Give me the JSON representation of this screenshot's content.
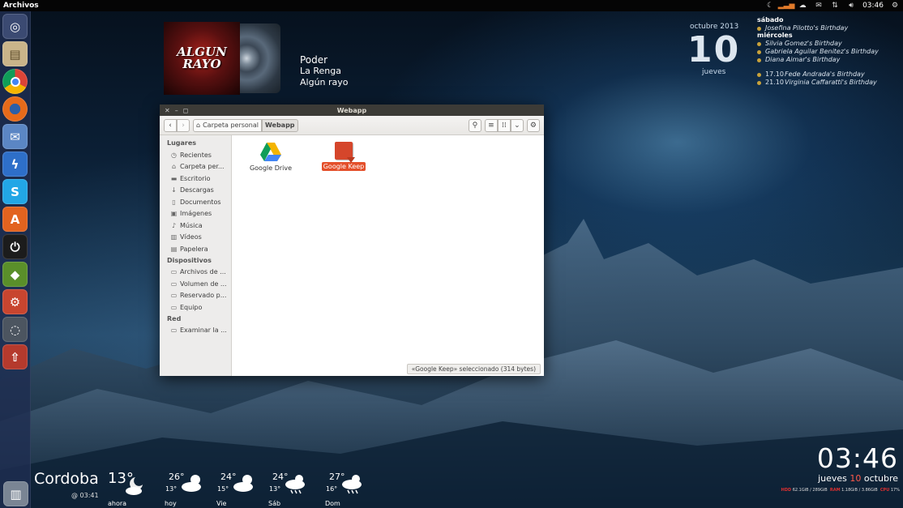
{
  "top_panel": {
    "title": "Archivos",
    "time": "03:46",
    "indicators": [
      "weather-icon",
      "bars-icon",
      "cloud-icon",
      "network-icon",
      "mail-icon",
      "network-arrows-icon",
      "volume-icon",
      "gear-icon"
    ]
  },
  "launcher": {
    "items": [
      {
        "name": "dash",
        "color": "#3b4a72",
        "glyph": "◎"
      },
      {
        "name": "files",
        "color": "#c9b48a",
        "glyph": "▤"
      },
      {
        "name": "chrome",
        "color": "#d9d9d9",
        "glyph": "◉"
      },
      {
        "name": "firefox",
        "color": "#e66a1a",
        "glyph": "◍"
      },
      {
        "name": "thunderbird",
        "color": "#5b86c4",
        "glyph": "✉"
      },
      {
        "name": "messenger",
        "color": "#2e6fc9",
        "glyph": "⚡"
      },
      {
        "name": "skype",
        "color": "#22a6e6",
        "glyph": "S"
      },
      {
        "name": "software-center",
        "color": "#e2631f",
        "glyph": "A"
      },
      {
        "name": "power-app",
        "color": "#222222",
        "glyph": "⏻"
      },
      {
        "name": "terminal-app",
        "color": "#5a8f2a",
        "glyph": "◆"
      },
      {
        "name": "settings",
        "color": "#c8452f",
        "glyph": "⚙"
      },
      {
        "name": "steam",
        "color": "#4c5560",
        "glyph": "◌"
      },
      {
        "name": "uploader",
        "color": "#b53a2d",
        "glyph": "⇧"
      },
      {
        "name": "trash",
        "color": "#7a8594",
        "glyph": "🗑"
      }
    ]
  },
  "music": {
    "album_line1": "ALGUN",
    "album_line2": "RAYO",
    "title": "Poder",
    "artist": "La Renga",
    "album": "Algún rayo"
  },
  "calendar": {
    "month": "octubre 2013",
    "day": "10",
    "weekday": "jueves",
    "groups": [
      {
        "heading": "sábado",
        "events": [
          {
            "date": "",
            "text": "Josefina Pilotto's Birthday"
          }
        ]
      },
      {
        "heading": "miércoles",
        "events": [
          {
            "date": "",
            "text": "Silvia Gomez's Birthday"
          },
          {
            "date": "",
            "text": "Gabriela Aguilar Benitez's Birthday"
          },
          {
            "date": "",
            "text": "Diana Aimar's Birthday"
          }
        ]
      },
      {
        "heading": "",
        "events": [
          {
            "date": "17.10",
            "text": "Fede Andrada's Birthday"
          },
          {
            "date": "21.10",
            "text": "Virginia Caffaratti's Birthday"
          }
        ]
      }
    ]
  },
  "window": {
    "title": "Webapp",
    "breadcrumb": [
      "Carpeta personal",
      "Webapp"
    ],
    "sidebar": [
      {
        "heading": "Lugares",
        "items": [
          {
            "label": "Recientes",
            "icon": "clock-icon",
            "glyph": "◷"
          },
          {
            "label": "Carpeta per...",
            "icon": "home-icon",
            "glyph": "⌂"
          },
          {
            "label": "Escritorio",
            "icon": "desktop-icon",
            "glyph": "▬"
          },
          {
            "label": "Descargas",
            "icon": "download-icon",
            "glyph": "↓"
          },
          {
            "label": "Documentos",
            "icon": "document-icon",
            "glyph": "▯"
          },
          {
            "label": "Imágenes",
            "icon": "camera-icon",
            "glyph": "▣"
          },
          {
            "label": "Música",
            "icon": "music-icon",
            "glyph": "♪"
          },
          {
            "label": "Vídeos",
            "icon": "film-icon",
            "glyph": "▥"
          },
          {
            "label": "Papelera",
            "icon": "trash-icon",
            "glyph": "▤"
          }
        ]
      },
      {
        "heading": "Dispositivos",
        "items": [
          {
            "label": "Archivos de ...",
            "icon": "drive-icon",
            "glyph": "▭"
          },
          {
            "label": "Volumen de ...",
            "icon": "drive-icon",
            "glyph": "▭"
          },
          {
            "label": "Reservado p...",
            "icon": "drive-icon",
            "glyph": "▭"
          },
          {
            "label": "Equipo",
            "icon": "computer-icon",
            "glyph": "▭"
          }
        ]
      },
      {
        "heading": "Red",
        "items": [
          {
            "label": "Examinar la ...",
            "icon": "network-icon",
            "glyph": "▭"
          }
        ]
      }
    ],
    "files": [
      {
        "name": "Google Drive",
        "selected": false
      },
      {
        "name": "Google Keep",
        "selected": true
      }
    ],
    "status": "«Google Keep» seleccionado  (314 bytes)"
  },
  "weather": {
    "city": "Cordoba",
    "updated": "@ 03:41",
    "now": {
      "temp": "13°",
      "label": "ahora"
    },
    "forecast": [
      {
        "label": "hoy",
        "hi": "26°",
        "lo": "13°"
      },
      {
        "label": "Vie",
        "hi": "24°",
        "lo": "15°"
      },
      {
        "label": "Sáb",
        "hi": "24°",
        "lo": "13°"
      },
      {
        "label": "Dom",
        "hi": "27°",
        "lo": "16°"
      }
    ]
  },
  "clock": {
    "time": "03:46",
    "weekday": "jueves",
    "day": "10",
    "month": "octubre"
  },
  "system": {
    "hdd_label": "HDD",
    "hdd_value": "62.1GiB / 289GiB",
    "ram_label": "RAM",
    "ram_value": "1.18GiB / 3.86GiB",
    "cpu_label": "CPU",
    "cpu_value": "17%"
  }
}
